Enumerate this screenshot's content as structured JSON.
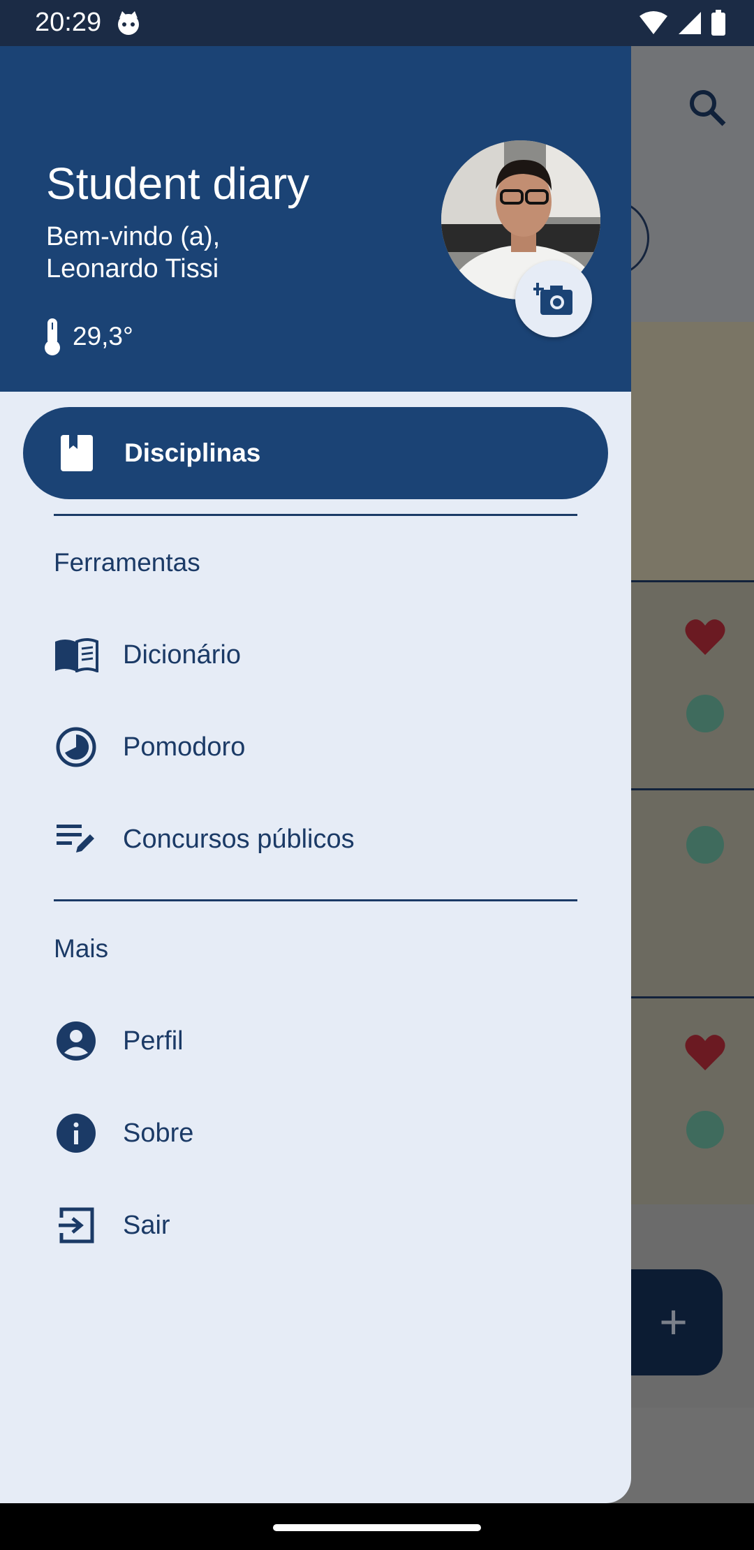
{
  "status_bar": {
    "time": "20:29",
    "icons": [
      "cat-icon",
      "wifi-icon",
      "signal-icon",
      "battery-icon"
    ]
  },
  "drawer": {
    "title": "Student diary",
    "welcome_line1": "Bem-vindo (a),",
    "welcome_line2": "Leonardo Tissi",
    "temperature": "29,3°",
    "active_item": {
      "label": "Disciplinas",
      "icon": "book-icon"
    },
    "sections": [
      {
        "title": "Ferramentas",
        "items": [
          {
            "label": "Dicionário",
            "icon": "open-book-icon"
          },
          {
            "label": "Pomodoro",
            "icon": "timer-icon"
          },
          {
            "label": "Concursos públicos",
            "icon": "edit-list-icon"
          }
        ]
      },
      {
        "title": "Mais",
        "items": [
          {
            "label": "Perfil",
            "icon": "account-circle-icon"
          },
          {
            "label": "Sobre",
            "icon": "info-icon"
          },
          {
            "label": "Sair",
            "icon": "logout-icon"
          }
        ]
      }
    ]
  },
  "colors": {
    "primary": "#1b4375",
    "drawer_bg": "#e6ecf6",
    "text": "#1b3a66",
    "statusbar": "#1b2b45"
  },
  "background_app": {
    "fab_label": "+"
  }
}
